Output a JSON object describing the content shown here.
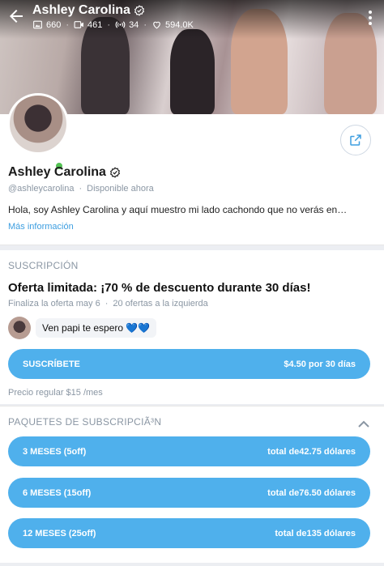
{
  "header": {
    "name": "Ashley Carolina",
    "stats": {
      "photos": "660",
      "videos": "461",
      "streams": "34",
      "likes": "594.0K"
    }
  },
  "profile": {
    "name": "Ashley Carolina",
    "handle": "@ashleycarolina",
    "status": "Disponible ahora",
    "bio": "Hola, soy Ashley Carolina y aquí muestro mi lado cachondo que no verás en…",
    "more_link": "Más información"
  },
  "subscription": {
    "section_label": "SUSCRIPCIÓN",
    "offer_title": "Oferta limitada: ¡70 % de descuento durante 30 días!",
    "offer_ends": "Finaliza la oferta may 6",
    "offers_left": "20 ofertas a la izquierda",
    "message": "Ven papi te espero",
    "message_emoji": "💙💙",
    "subscribe_label": "SUSCRÍBETE",
    "subscribe_price": "$4.50 por 30 días",
    "regular_price": "Precio regular $15 /mes"
  },
  "bundles": {
    "section_label": "PAQUETES DE SUBSCRIPCIÃ³N",
    "items": [
      {
        "label": "3 MESES (5off)",
        "price": "total de42.75 dólares"
      },
      {
        "label": "6 MESES (15off)",
        "price": "total de76.50 dólares"
      },
      {
        "label": "12 MESES (25off)",
        "price": "total de135 dólares"
      }
    ]
  },
  "colors": {
    "accent": "#4fb0ec",
    "link": "#3d9ee0",
    "online": "#53c253",
    "muted": "#8a96a3"
  },
  "icons": [
    "back-arrow-icon",
    "verified-icon",
    "image-icon",
    "video-icon",
    "broadcast-icon",
    "heart-icon",
    "more-vertical-icon",
    "share-icon",
    "chevron-up-icon"
  ]
}
